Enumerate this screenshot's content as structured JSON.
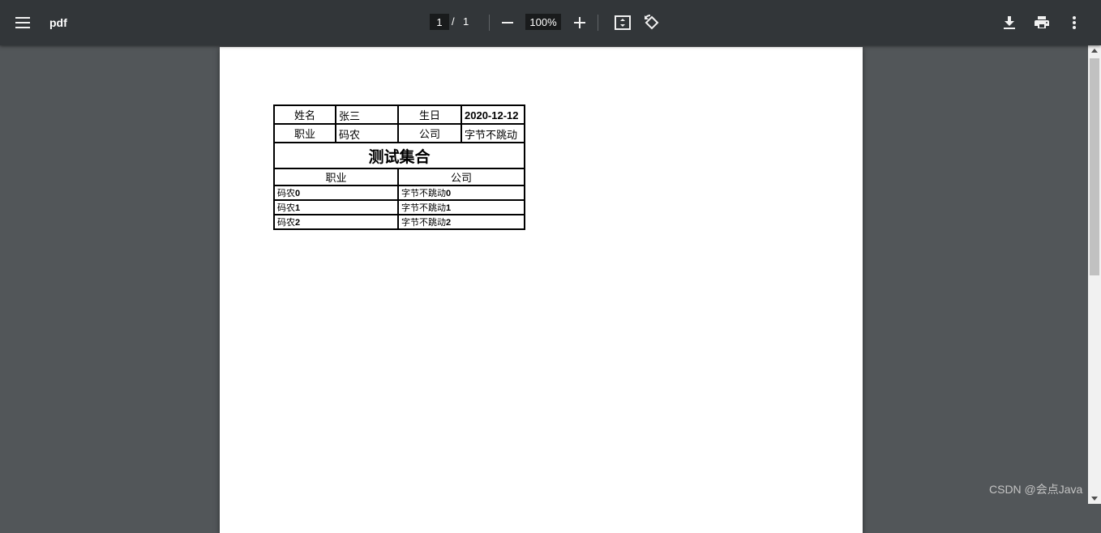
{
  "toolbar": {
    "title": "pdf",
    "page_current": "1",
    "page_separator": "/",
    "page_total": "1",
    "zoom": "100%",
    "icons": {
      "menu": "hamburger-menu-icon",
      "zoom_out": "minus-icon",
      "zoom_in": "plus-icon",
      "fit": "fit-to-page-icon",
      "rotate": "rotate-counterclockwise-icon",
      "download": "download-icon",
      "print": "print-icon",
      "more": "more-vertical-icon"
    }
  },
  "document": {
    "info_rows": [
      {
        "label1": "姓名",
        "value1": "张三",
        "label2": "生日",
        "value2": "2020-12-12"
      },
      {
        "label1": "职业",
        "value1": "码农",
        "label2": "公司",
        "value2": "字节不跳动"
      }
    ],
    "collection_title": "测试集合",
    "columns": [
      "职业",
      "公司"
    ],
    "rows": [
      {
        "job_prefix": "码农",
        "job_index": "0",
        "company_prefix": "字节不跳动",
        "company_index": "0"
      },
      {
        "job_prefix": "码农",
        "job_index": "1",
        "company_prefix": "字节不跳动",
        "company_index": "1"
      },
      {
        "job_prefix": "码农",
        "job_index": "2",
        "company_prefix": "字节不跳动",
        "company_index": "2"
      }
    ]
  },
  "watermark": "CSDN @会点Java",
  "colors": {
    "toolbar_bg": "#323639",
    "viewer_bg": "#525659",
    "page_bg": "#ffffff",
    "input_bg": "#191b1c"
  }
}
